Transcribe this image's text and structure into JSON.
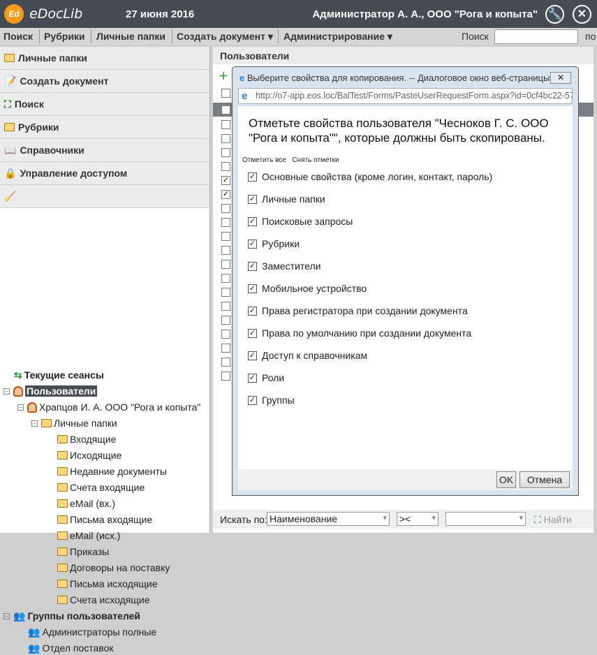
{
  "header": {
    "logo": "Ed",
    "brand": "eDocLib",
    "date": "27 июня 2016",
    "user": "Администратор А. А., ООО \"Рога и копыта\"",
    "icons": [
      "wrench-icon",
      "close-icon"
    ]
  },
  "menu": {
    "items": [
      "Поиск",
      "Рубрики",
      "Личные папки",
      "Создать документ",
      "Администрирование"
    ],
    "search_label": "Поиск",
    "search_value": "",
    "cut_label": "по"
  },
  "accordion": [
    "Личные папки",
    "Создать документ",
    "Поиск",
    "Рубрики",
    "Справочники",
    "Управление доступом"
  ],
  "tree": {
    "sessions": "Текущие сеансы",
    "users": "Пользователи",
    "user1": "Храпцов И. А. ООО \"Рога и копыта\"",
    "personal": "Личные папки",
    "folders": [
      "Входящие",
      "Исходящие",
      "Недавние документы",
      "Счета входящие",
      "eMail (вх.)",
      "Письма входящие",
      "eMail (исх.)",
      "Приказы",
      "Договоры на поставку",
      "Письма исходящие",
      "Счета исходящие"
    ],
    "groups": "Группы пользователей",
    "group_items": [
      "Администраторы полные",
      "Отдел поставок"
    ]
  },
  "right": {
    "title": "Пользователи",
    "grid_checked": [
      false,
      false,
      false,
      false,
      true,
      true,
      false,
      false,
      false,
      false,
      false,
      false,
      false,
      false,
      false,
      false,
      false,
      false,
      false
    ]
  },
  "bottom": {
    "search_by_label": "Искать по:",
    "field": "Наименование",
    "operator": "><",
    "value": "",
    "find": "Найти"
  },
  "dialog": {
    "title": "Выберите свойства для копирования. -- Диалоговое окно веб-страницы",
    "url": "http://o7-app.eos.loc/BalTest/Forms/PasteUserRequestForm.aspx?id=0cf4bc22-572d-",
    "heading": "Отметьте свойства пользователя \"Чесноков Г. С. ООО \"Рога и копыта\"\", которые должны быть скопированы.",
    "check_all": "Отметить все",
    "uncheck_all": "Снять отметки",
    "options": [
      {
        "label": "Основные свойства (кроме логин, контакт, пароль)",
        "checked": true
      },
      {
        "label": "Личные папки",
        "checked": true
      },
      {
        "label": "Поисковые запросы",
        "checked": true
      },
      {
        "label": "Рубрики",
        "checked": true
      },
      {
        "label": "Заместители",
        "checked": true
      },
      {
        "label": "Мобильное устройство",
        "checked": true
      },
      {
        "label": "Права регистратора при создании документа",
        "checked": true
      },
      {
        "label": "Права по умолчанию при создании документа",
        "checked": true
      },
      {
        "label": "Доступ к справочникам",
        "checked": true
      },
      {
        "label": "Роли",
        "checked": true
      },
      {
        "label": "Группы",
        "checked": true
      }
    ],
    "ok": "OK",
    "cancel": "Отмена"
  }
}
